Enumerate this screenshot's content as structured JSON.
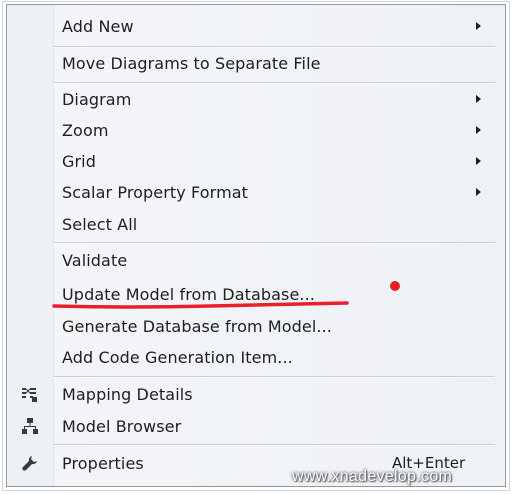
{
  "menu": {
    "add_new": "Add New",
    "move_diagrams": "Move Diagrams to Separate File",
    "diagram": "Diagram",
    "zoom": "Zoom",
    "grid": "Grid",
    "scalar_property_format": "Scalar Property Format",
    "select_all": "Select All",
    "validate": "Validate",
    "update_model": "Update Model from Database...",
    "generate_database": "Generate Database from Model...",
    "add_code_generation": "Add Code Generation Item...",
    "mapping_details": "Mapping Details",
    "model_browser": "Model Browser",
    "properties": "Properties",
    "properties_shortcut": "Alt+Enter"
  },
  "icons": {
    "mapping_details": "mapping-details-icon",
    "model_browser": "model-browser-icon",
    "properties": "wrench-icon"
  },
  "annotation": {
    "underline_color": "#e8202a",
    "dot_color": "#e8202a"
  },
  "watermark": "www.xnadevelop.com"
}
